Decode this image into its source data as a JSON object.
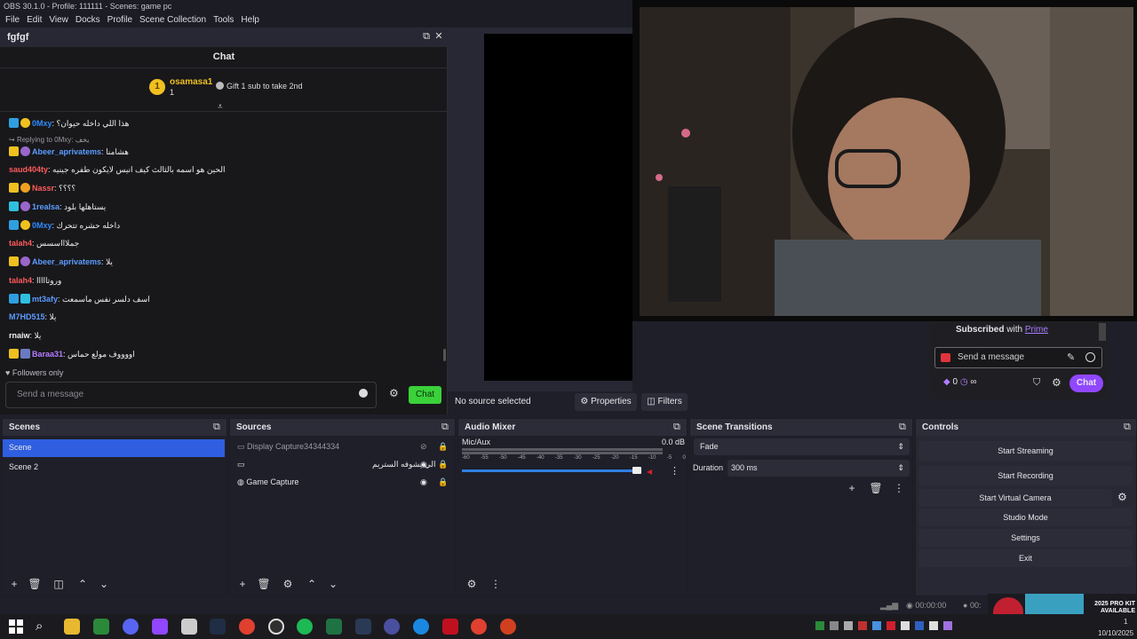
{
  "window": {
    "title": "OBS 30.1.0 - Profile: 111111 - Scenes: game pc"
  },
  "menu": [
    "File",
    "Edit",
    "View",
    "Docks",
    "Profile",
    "Scene Collection",
    "Tools",
    "Help"
  ],
  "chat_dock": {
    "title": "fgfgf",
    "header": "Chat",
    "pinned": {
      "user": "osamasa1",
      "count": "1",
      "gift": "Gift 1 sub to take 2nd"
    },
    "messages": [
      {
        "user": "0Mxy",
        "text": ": هذا اللي داخله حيوان؟",
        "color": "#2e8bff"
      },
      {
        "user": "",
        "text": "Replying to 0Mxy: يخف",
        "color": "#aaaaaa"
      },
      {
        "user": "Abeer_aprivatems",
        "text": ": هشامنا",
        "color": "#5c9cff"
      },
      {
        "user": "saud404ty",
        "text": ": الحين هو اسمه بالثالث كيف انيس لايكون طفره جينيه",
        "color": "#ff5a5a"
      },
      {
        "user": "Nassr",
        "text": ": ؟؟؟؟",
        "color": "#ff5a5a"
      },
      {
        "user": "1realsa",
        "text": ": يستاهلها بلود",
        "color": "#5c9cff"
      },
      {
        "user": "0Mxy",
        "text": ": داخله حشره تتحرك",
        "color": "#2e8bff"
      },
      {
        "user": "talah4",
        "text": ": جملاااسسس",
        "color": "#ff5a5a"
      },
      {
        "user": "Abeer_aprivatems",
        "text": ": يلا",
        "color": "#5c9cff"
      },
      {
        "user": "talah4",
        "text": ": وروتااااا",
        "color": "#ff5a5a"
      },
      {
        "user": "mt3afy",
        "text": ": اسف دلسر نفس ماسمعت",
        "color": "#5c9cff"
      },
      {
        "user": "M7HD515",
        "text": ": يلا",
        "color": "#5c9cff"
      },
      {
        "user": "rnaiw",
        "text": ": يلا",
        "color": "#efeff1"
      },
      {
        "user": "Baraa31",
        "text": ": اووووف مولع حماس",
        "color": "#b57bff"
      }
    ],
    "followers_only": "Followers only",
    "send_placeholder": "Send a message",
    "chat_button": "Chat"
  },
  "source_bar": {
    "status": "No source selected",
    "properties": "Properties",
    "filters": "Filters"
  },
  "twitch_overlay": {
    "subscribed": "Subscribed",
    "with": "with",
    "prime": "Prime",
    "placeholder": "Send a message",
    "points": "0",
    "infinity": "∞",
    "chat": "Chat"
  },
  "scenes": {
    "title": "Scenes",
    "items": [
      "Scene",
      "Scene 2"
    ]
  },
  "sources": {
    "title": "Sources",
    "items": [
      "Display Capture34344334",
      "الي يشوفه الستريم",
      "Game Capture"
    ]
  },
  "audio_mixer": {
    "title": "Audio Mixer",
    "channel": "Mic/Aux",
    "level": "0.0 dB",
    "ticks": [
      "-60",
      "-55",
      "-50",
      "-45",
      "-40",
      "-35",
      "-30",
      "-25",
      "-20",
      "-15",
      "-10",
      "-5",
      "0"
    ]
  },
  "transitions": {
    "title": "Scene Transitions",
    "type": "Fade",
    "duration_label": "Duration",
    "duration": "300 ms"
  },
  "controls": {
    "title": "Controls",
    "buttons": [
      "Start Streaming",
      "Start Recording",
      "Start Virtual Camera",
      "Studio Mode",
      "Settings",
      "Exit"
    ]
  },
  "statusbar": {
    "time1": "00:00:00",
    "time2": "00:"
  },
  "tray": {
    "ad": "2025 PRO KIT AVAILABLE NOW !",
    "date": "10/10/2025",
    "clock_fragment": "1"
  },
  "colors": {
    "accent": "#2f5fe0",
    "twitch": "#9147ff",
    "chat_button": "#3ad13a"
  }
}
